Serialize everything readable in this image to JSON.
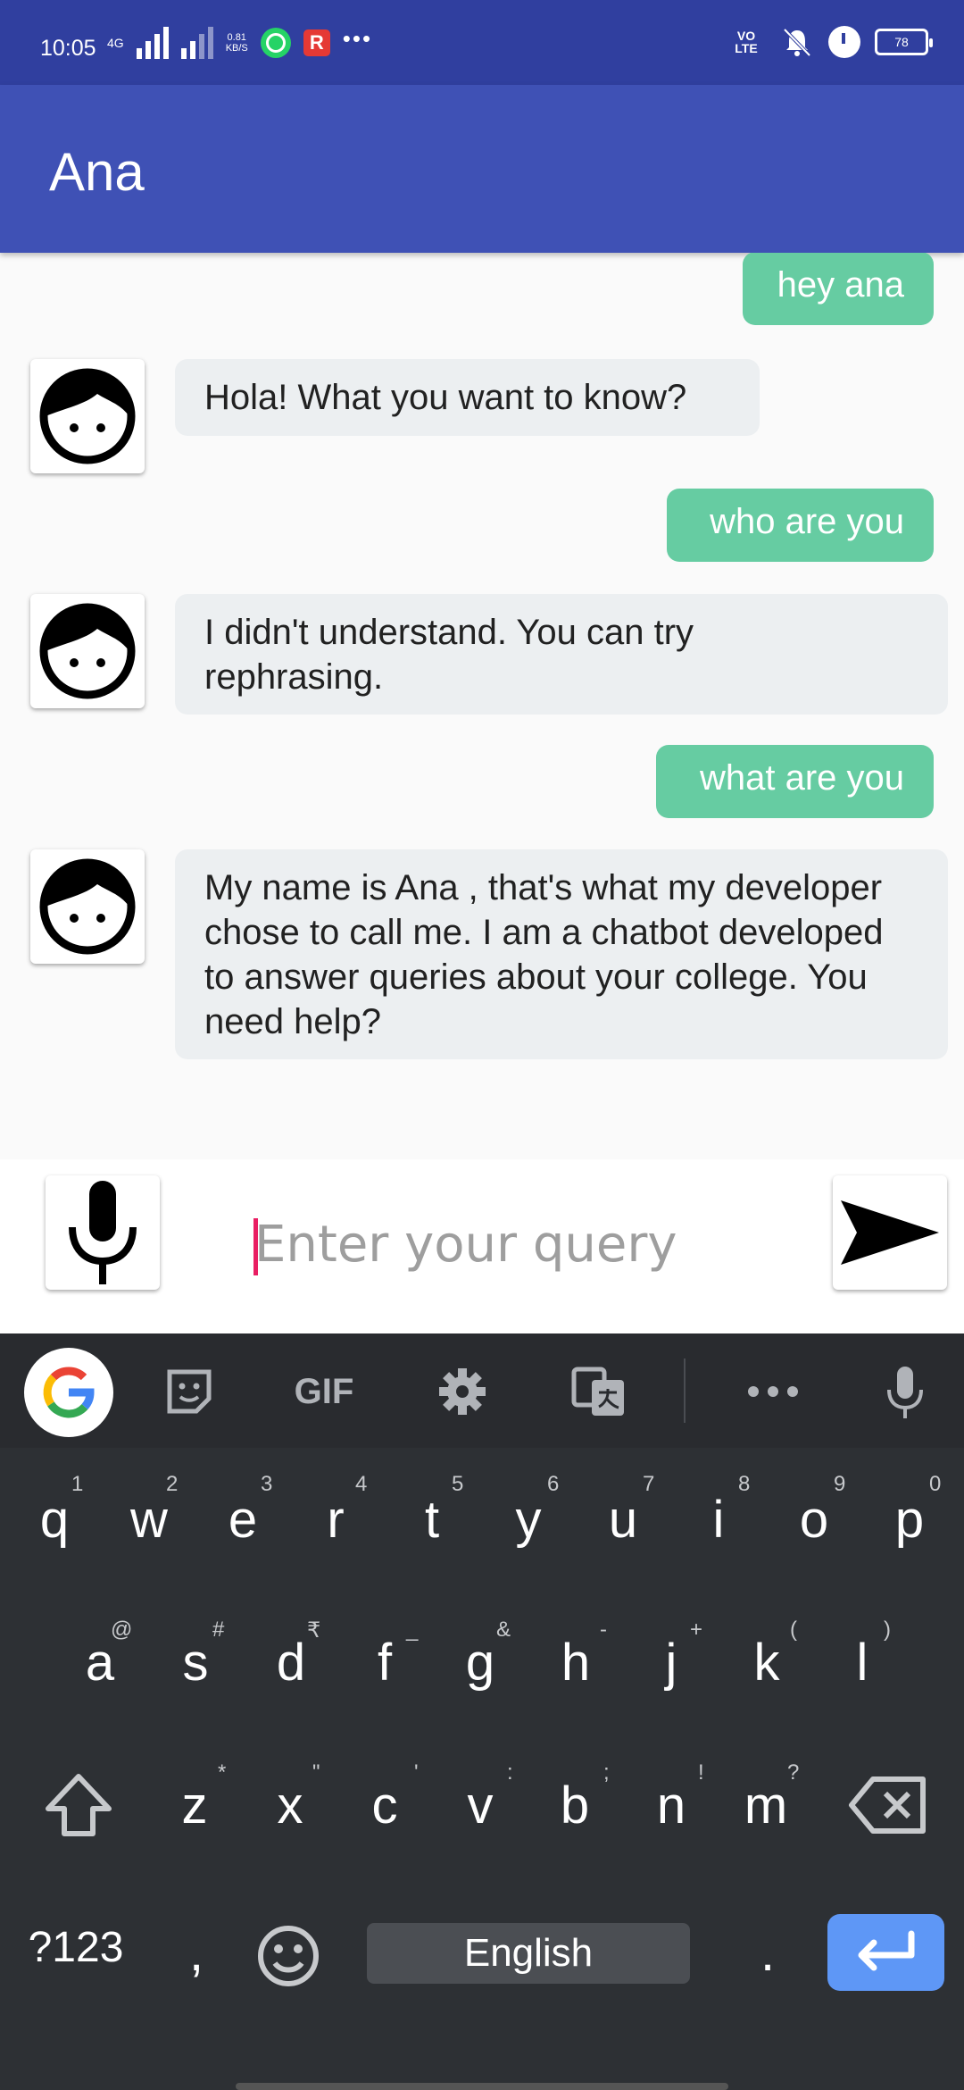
{
  "status_bar": {
    "time": "10:05",
    "network_label": "4G",
    "speed_value": "0.81",
    "speed_unit": "KB/S",
    "r_badge": "R",
    "more": "•••",
    "volte": "VO LTE",
    "battery": "78"
  },
  "app_bar": {
    "title": "Ana"
  },
  "chat": {
    "messages": [
      {
        "sender": "user",
        "text": "hey ana"
      },
      {
        "sender": "bot",
        "text": "Hola! What you want to know?"
      },
      {
        "sender": "user",
        "text": "who are you"
      },
      {
        "sender": "bot",
        "text": "I didn't understand. You can try rephrasing."
      },
      {
        "sender": "user",
        "text": "what are you"
      },
      {
        "sender": "bot",
        "text": "My name is Ana , that's what my developer chose to call me. I am a chatbot developed to answer queries about your college. You need  help?"
      }
    ]
  },
  "input": {
    "placeholder": "Enter your query",
    "value": ""
  },
  "keyboard": {
    "toolbar": {
      "gif": "GIF"
    },
    "row1": {
      "keys": [
        "q",
        "w",
        "e",
        "r",
        "t",
        "y",
        "u",
        "i",
        "o",
        "p"
      ],
      "hints": [
        "1",
        "2",
        "3",
        "4",
        "5",
        "6",
        "7",
        "8",
        "9",
        "0"
      ]
    },
    "row2": {
      "keys": [
        "a",
        "s",
        "d",
        "f",
        "g",
        "h",
        "j",
        "k",
        "l"
      ],
      "hints": [
        "@",
        "#",
        "₹",
        "_",
        "&",
        "-",
        "+",
        "(",
        ")"
      ]
    },
    "row3": {
      "keys": [
        "z",
        "x",
        "c",
        "v",
        "b",
        "n",
        "m"
      ],
      "hints": [
        "*",
        "\"",
        "'",
        ":",
        ";",
        "!",
        "?"
      ]
    },
    "symbols_key": "?123",
    "comma_key": ",",
    "space_label": "English",
    "period_key": "."
  },
  "colors": {
    "status_bar": "#303f9f",
    "app_bar": "#3f51b5",
    "user_bubble": "#66cca2",
    "bot_bubble": "#eceff1",
    "enter_key": "#5e97f6"
  }
}
